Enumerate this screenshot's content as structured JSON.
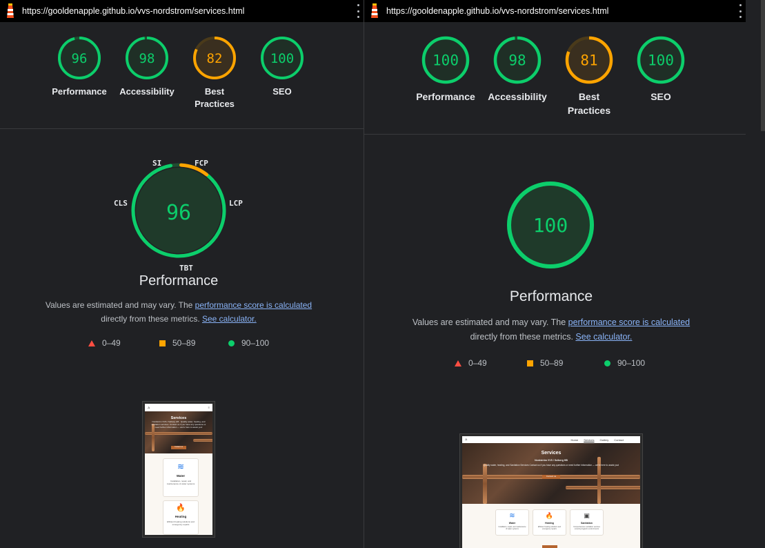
{
  "left": {
    "url": "https://gooldenapple.github.io/vvs-nordstrom/services.html",
    "scores": [
      {
        "value": "96",
        "label_lines": [
          "Performance"
        ],
        "color": "#0cce6b",
        "fraction": 0.96
      },
      {
        "value": "98",
        "label_lines": [
          "Accessibility"
        ],
        "color": "#0cce6b",
        "fraction": 0.98
      },
      {
        "value": "82",
        "label_lines": [
          "Best",
          "Practices"
        ],
        "color": "#ffa400",
        "fraction": 0.82
      },
      {
        "value": "100",
        "label_lines": [
          "SEO"
        ],
        "color": "#0cce6b",
        "fraction": 1.0
      }
    ],
    "gauge": {
      "value": "96",
      "fraction": 0.96
    },
    "metrics": {
      "si": "SI",
      "fcp": "FCP",
      "lcp": "LCP",
      "tbt": "TBT",
      "cls": "CLS"
    },
    "perf_title": "Performance",
    "desc_prefix": "Values are estimated and may vary. The ",
    "desc_link": "performance score is calculated",
    "desc_line2": "directly from these metrics.",
    "calc_link": "See calculator.",
    "legend": [
      "0–49",
      "50–89",
      "90–100"
    ],
    "thumb": {
      "hero_title": "Services",
      "hero_sub": "Nordström VVS / Solberg HB · Quality water, heating, and sanitation services. Contact us if you have any questions or need further information — we're here to assist you!",
      "hero_btn": "Contact us",
      "cards": [
        {
          "icon": "water-waves-icon",
          "title": "Water",
          "desc": "Installation, repair, and maintenance of water systems"
        },
        {
          "icon": "flame-icon",
          "title": "Heating",
          "desc": "Efficient heating solutions and emergency repairs"
        }
      ]
    }
  },
  "right": {
    "url": "https://gooldenapple.github.io/vvs-nordstrom/services.html",
    "scores": [
      {
        "value": "100",
        "label_lines": [
          "Performance"
        ],
        "color": "#0cce6b",
        "fraction": 1.0
      },
      {
        "value": "98",
        "label_lines": [
          "Accessibility"
        ],
        "color": "#0cce6b",
        "fraction": 0.98
      },
      {
        "value": "81",
        "label_lines": [
          "Best",
          "Practices"
        ],
        "color": "#ffa400",
        "fraction": 0.81
      },
      {
        "value": "100",
        "label_lines": [
          "SEO"
        ],
        "color": "#0cce6b",
        "fraction": 1.0
      }
    ],
    "gauge": {
      "value": "100",
      "fraction": 1.0
    },
    "perf_title": "Performance",
    "desc_prefix": "Values are estimated and may vary. The ",
    "desc_link": "performance score is calculated",
    "desc_line2": "directly from these metrics.",
    "calc_link": "See calculator.",
    "legend": [
      "0–49",
      "50–89",
      "90–100"
    ],
    "thumb": {
      "nav": [
        "Home",
        "Services",
        "Gallery",
        "Contact"
      ],
      "hero_title": "Services",
      "hero_sub1": "Nordström VVS / Solberg HB",
      "hero_sub2": "Quality water, heating, and Sanitation Services Contact us if you have any questions or need further information — we're here to assist you!",
      "hero_btn": "Contact us",
      "cards": [
        {
          "icon": "water-waves-icon",
          "title": "Water",
          "desc": "Installation, repair, and maintenance of water systems"
        },
        {
          "icon": "flame-icon",
          "title": "Heating",
          "desc": "Efficient heating solutions and emergency repairs"
        },
        {
          "icon": "toilet-icon",
          "title": "Sanitation",
          "desc": "Comprehensive sanitation services ensuring hygienic environments"
        }
      ]
    }
  },
  "colors": {
    "good": "#0cce6b",
    "average": "#ffa400",
    "fail": "#ff4e42",
    "link": "#8ab4f8"
  }
}
